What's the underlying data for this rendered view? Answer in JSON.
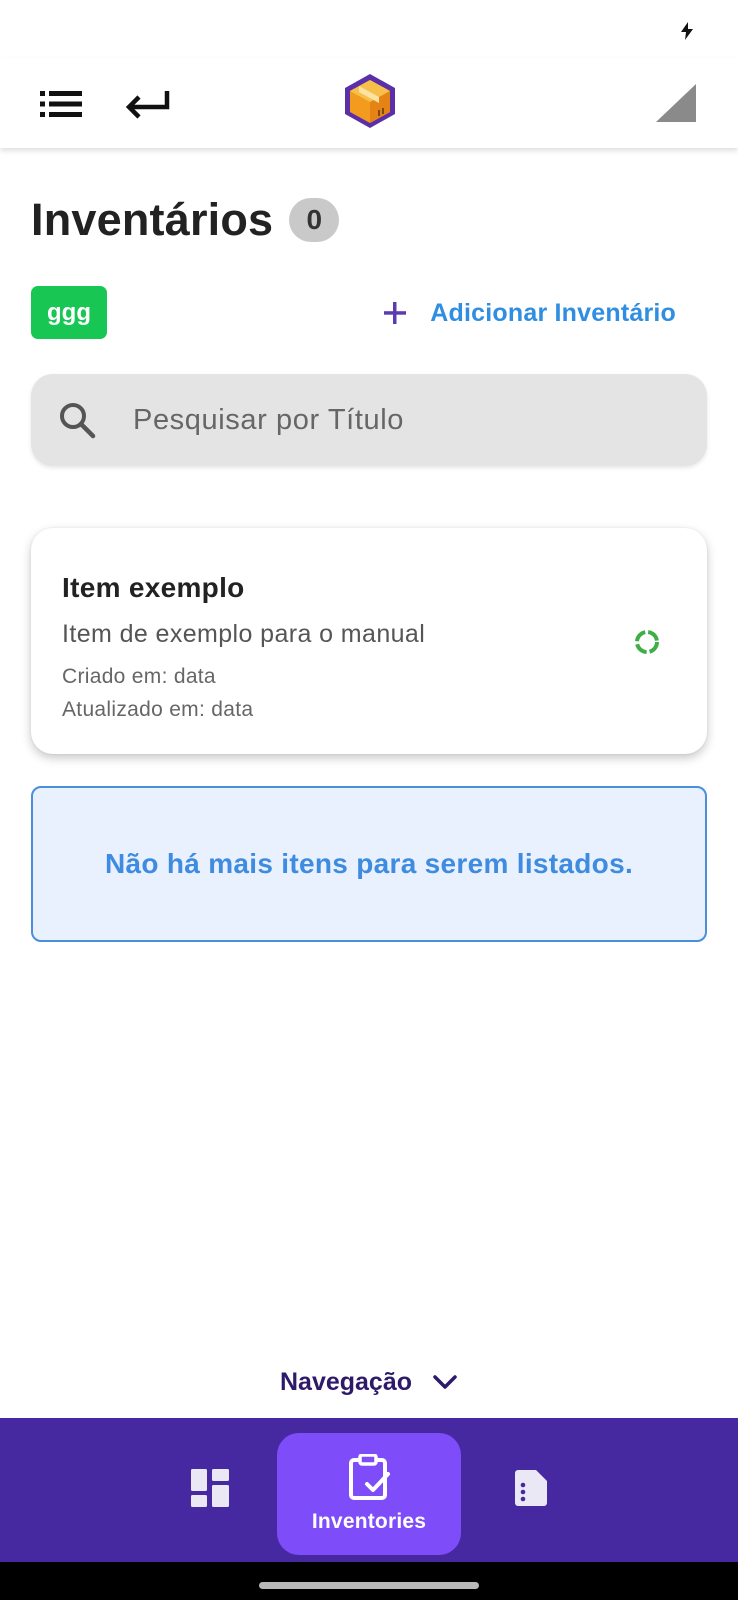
{
  "header": {
    "menu_icon": "list-menu-icon",
    "back_icon": "return-arrow-icon",
    "logo_icon": "package-box-logo",
    "signal_icon": "cell-signal-icon"
  },
  "page": {
    "title": "Inventários",
    "count": "0"
  },
  "toolbar": {
    "tag_label": "ggg",
    "add_label": "Adicionar Inventário",
    "tag_color": "#17c653",
    "accent_color": "#2f8ee0"
  },
  "search": {
    "placeholder": "Pesquisar por Título",
    "value": ""
  },
  "items": [
    {
      "title": "Item exemplo",
      "description": "Item de exemplo para o manual",
      "created": "Criado em: data",
      "updated": "Atualizado em: data",
      "status_icon": "loading-circle-icon",
      "status_color": "#3fae49"
    }
  ],
  "empty_message": "Não há mais itens para serem listados.",
  "navigation": {
    "toggle_label": "Navegação",
    "items": [
      {
        "icon": "dashboard-icon",
        "label": ""
      },
      {
        "icon": "clipboard-check-icon",
        "label": "Inventories",
        "active": true
      },
      {
        "icon": "document-icon",
        "label": ""
      }
    ],
    "bar_color": "#4628a0",
    "active_color": "#7e4cf8"
  }
}
